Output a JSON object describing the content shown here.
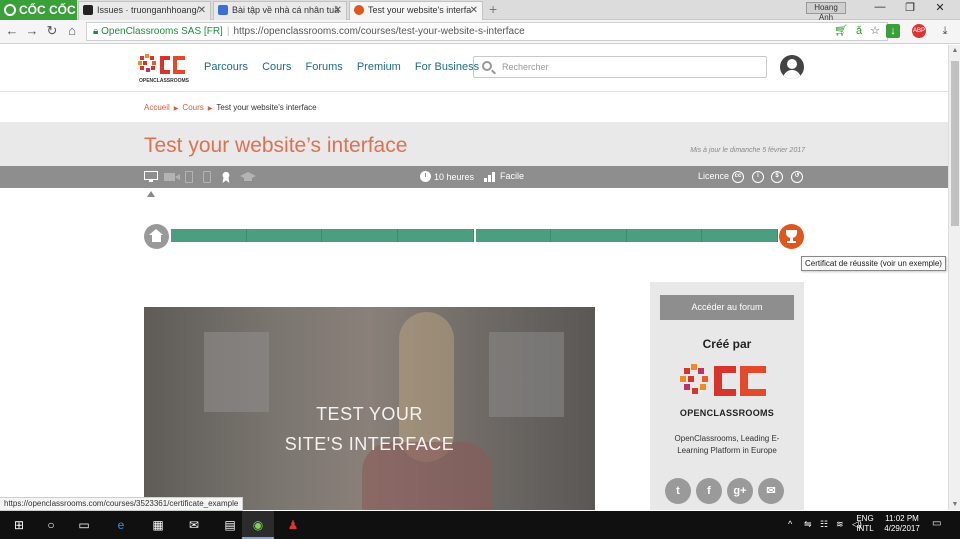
{
  "browser": {
    "brand_label": "CỐC CỐC",
    "tabs": [
      {
        "title": "Issues · truonganhhoang/",
        "active": false
      },
      {
        "title": "Bài tập về nhà cá nhân tuầ",
        "active": false
      },
      {
        "title": "Test your website's interfa",
        "active": true
      }
    ],
    "user_chip": "Hoang Anh",
    "address": {
      "secure_label": "OpenClassrooms SAS [FR]",
      "url": "https://openclassrooms.com/courses/test-your-website-s-interface"
    }
  },
  "site": {
    "nav": [
      "Parcours",
      "Cours",
      "Forums",
      "Premium",
      "For Business"
    ],
    "search_placeholder": "Rechercher"
  },
  "breadcrumb": [
    "Accueil",
    "Cours",
    "Test your website's interface"
  ],
  "course": {
    "title": "Test your website’s interface",
    "updated": "Mis à jour le dimanche 5 février 2017",
    "duration": "10 heures",
    "level": "Facile",
    "licence_label": "Licence",
    "progress_percent": 100,
    "tooltip": "Certificat de réussite (voir un exemple)"
  },
  "video": {
    "title_line1": "TEST YOUR",
    "title_line2": "SITE'S INTERFACE"
  },
  "sidebar": {
    "forum_button": "Accéder au forum",
    "created_by": "Créé par",
    "logo_text": "OPENCLASSROOMS",
    "description": "OpenClassrooms, Leading E-Learning Platform in Europe",
    "social": [
      "twitter-icon",
      "facebook-icon",
      "google-plus-icon",
      "email-icon"
    ]
  },
  "status_url": "https://openclassrooms.com/courses/3523361/certificate_example",
  "taskbar": {
    "lang_line1": "ENG",
    "lang_line2": "INTL",
    "time": "11:02 PM",
    "date": "4/29/2017"
  },
  "colors": {
    "accent": "#e07052",
    "nav_link": "#1f6b86",
    "progress": "#4b9e80",
    "trophy": "#e0561f"
  }
}
